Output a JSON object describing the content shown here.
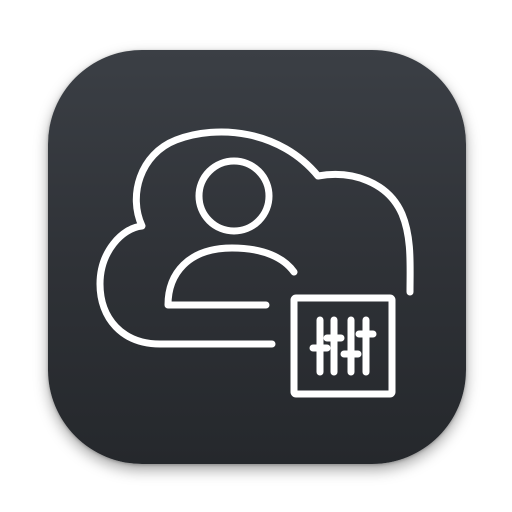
{
  "app_icon": {
    "name": "cloud-user-settings",
    "background_color": "#2e3136",
    "stroke_color": "#ffffff",
    "glyphs": [
      "cloud-icon",
      "user-icon",
      "sliders-icon"
    ]
  }
}
